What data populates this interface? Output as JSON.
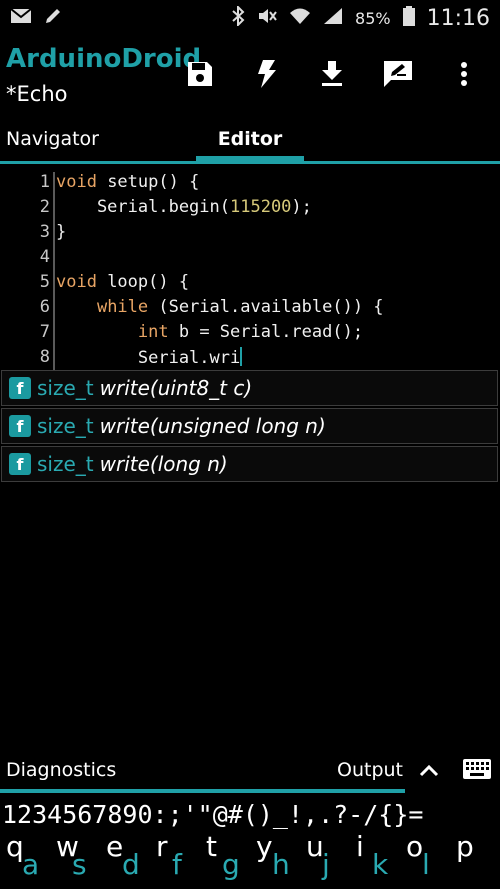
{
  "status": {
    "battery": "85%",
    "time": "11:16"
  },
  "app": {
    "title": "ArduinoDroid",
    "subtitle": "*Echo"
  },
  "actions": [
    "save-icon",
    "flash-icon",
    "download-icon",
    "edit-icon",
    "more-vert-icon"
  ],
  "tabs": {
    "navigator": "Navigator",
    "editor": "Editor",
    "active": "Editor"
  },
  "editor": {
    "lines": [
      {
        "n": "1",
        "segments": [
          [
            "kw",
            "void"
          ],
          [
            "t",
            " setup() {"
          ]
        ]
      },
      {
        "n": "2",
        "segments": [
          [
            "t",
            "    Serial.begin("
          ],
          [
            "num",
            "115200"
          ],
          [
            "t",
            ");"
          ]
        ]
      },
      {
        "n": "3",
        "segments": [
          [
            "t",
            "}"
          ]
        ]
      },
      {
        "n": "4",
        "segments": [
          [
            "t",
            ""
          ]
        ]
      },
      {
        "n": "5",
        "segments": [
          [
            "kw",
            "void"
          ],
          [
            "t",
            " loop() {"
          ]
        ]
      },
      {
        "n": "6",
        "segments": [
          [
            "t",
            "    "
          ],
          [
            "kw",
            "while"
          ],
          [
            "t",
            " (Serial.available()) {"
          ]
        ]
      },
      {
        "n": "7",
        "segments": [
          [
            "t",
            "        "
          ],
          [
            "kw",
            "int"
          ],
          [
            "t",
            " b = Serial.read();"
          ]
        ]
      },
      {
        "n": "8",
        "segments": [
          [
            "t",
            "        Serial.wri"
          ]
        ]
      }
    ]
  },
  "suggestions": [
    {
      "badge": "f",
      "type": "size_t",
      "sig": "write(uint8_t c)"
    },
    {
      "badge": "f",
      "type": "size_t",
      "sig": "write(unsigned long n)"
    },
    {
      "badge": "f",
      "type": "size_t",
      "sig": "write(long n)"
    }
  ],
  "bottom": {
    "diagnostics": "Diagnostics",
    "output": "Output"
  },
  "keyboard": {
    "symbols": "1234567890:;'\"@#()_!,.?-/{}=",
    "keys": [
      {
        "top": "q",
        "bottom": "a"
      },
      {
        "top": "w",
        "bottom": "s"
      },
      {
        "top": "e",
        "bottom": "d"
      },
      {
        "top": "r",
        "bottom": "f"
      },
      {
        "top": "t",
        "bottom": "g"
      },
      {
        "top": "y",
        "bottom": "h"
      },
      {
        "top": "u",
        "bottom": "j"
      },
      {
        "top": "i",
        "bottom": "k"
      },
      {
        "top": "o",
        "bottom": "l"
      },
      {
        "top": "p",
        "bottom": ""
      }
    ]
  },
  "colors": {
    "accent": "#1fa0a7",
    "keyword": "#e8a565",
    "number": "#d6c97a"
  }
}
